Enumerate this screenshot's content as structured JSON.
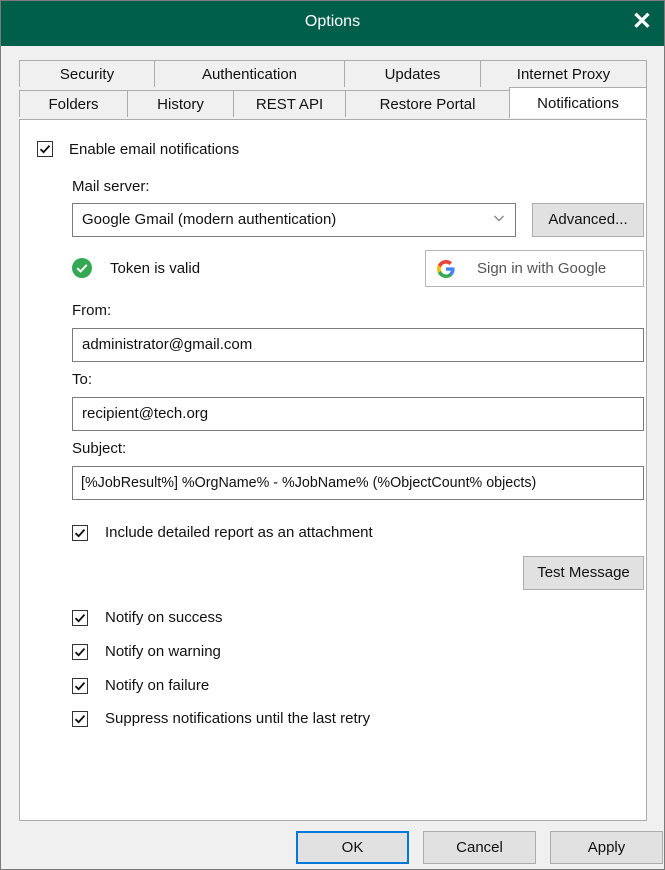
{
  "window": {
    "title": "Options",
    "close_glyph": "✕"
  },
  "tabs_row1": [
    "Security",
    "Authentication",
    "Updates",
    "Internet Proxy"
  ],
  "tabs_row2": [
    "Folders",
    "History",
    "REST API",
    "Restore Portal",
    "Notifications"
  ],
  "active_tab": "Notifications",
  "notifications": {
    "enable_label": "Enable email notifications",
    "enable_checked": true,
    "mail_server_label": "Mail server:",
    "mail_server_value": "Google Gmail (modern authentication)",
    "advanced_button": "Advanced...",
    "token_status": "Token is valid",
    "sign_in_button": "Sign in with Google",
    "from_label": "From:",
    "from_value": "administrator@gmail.com",
    "to_label": "To:",
    "to_value": "recipient@tech.org",
    "subject_label": "Subject:",
    "subject_value": "[%JobResult%] %OrgName% - %JobName% (%ObjectCount% objects)",
    "include_report_label": "Include detailed report as an attachment",
    "include_report_checked": true,
    "test_message_button": "Test Message",
    "notify_success_label": "Notify on success",
    "notify_success_checked": true,
    "notify_warning_label": "Notify on warning",
    "notify_warning_checked": true,
    "notify_failure_label": "Notify on failure",
    "notify_failure_checked": true,
    "suppress_label": "Suppress notifications until the last retry",
    "suppress_checked": true
  },
  "footer": {
    "ok": "OK",
    "cancel": "Cancel",
    "apply": "Apply"
  },
  "colors": {
    "titlebar": "#005f4b",
    "token_ok": "#34a853",
    "accent_border": "#0078d7"
  },
  "icons": {
    "google": "google-g-icon",
    "check": "check-circle-icon",
    "dropdown": "chevron-down-icon"
  }
}
